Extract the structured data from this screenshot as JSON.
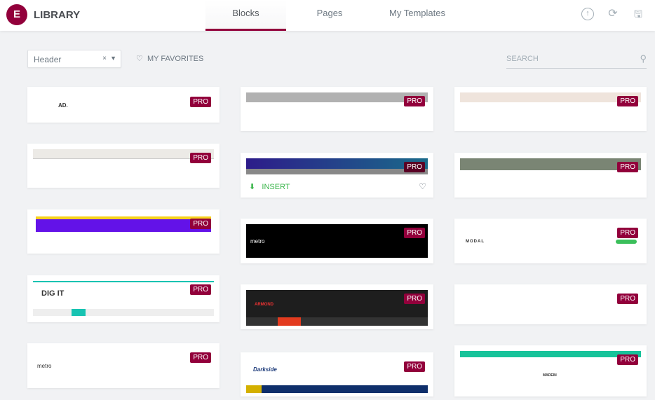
{
  "header": {
    "logo": "E",
    "title": "LIBRARY",
    "tabs": [
      {
        "label": "Blocks",
        "active": true
      },
      {
        "label": "Pages"
      },
      {
        "label": "My Templates"
      }
    ],
    "icons": [
      "upload-icon",
      "sync-icon",
      "save-icon"
    ]
  },
  "filters": {
    "category": "Header",
    "clear": "×",
    "favorites": "MY FAVORITES",
    "search_placeholder": "SEARCH"
  },
  "badge": "PRO",
  "hover_card": {
    "insert": "INSERT"
  },
  "accent": "#92003b",
  "thumb_logos": [
    "AD.",
    "metro",
    "metro",
    "ARMOND",
    "Darkside",
    "MODAL",
    "MADEIN",
    "DIG IT"
  ]
}
